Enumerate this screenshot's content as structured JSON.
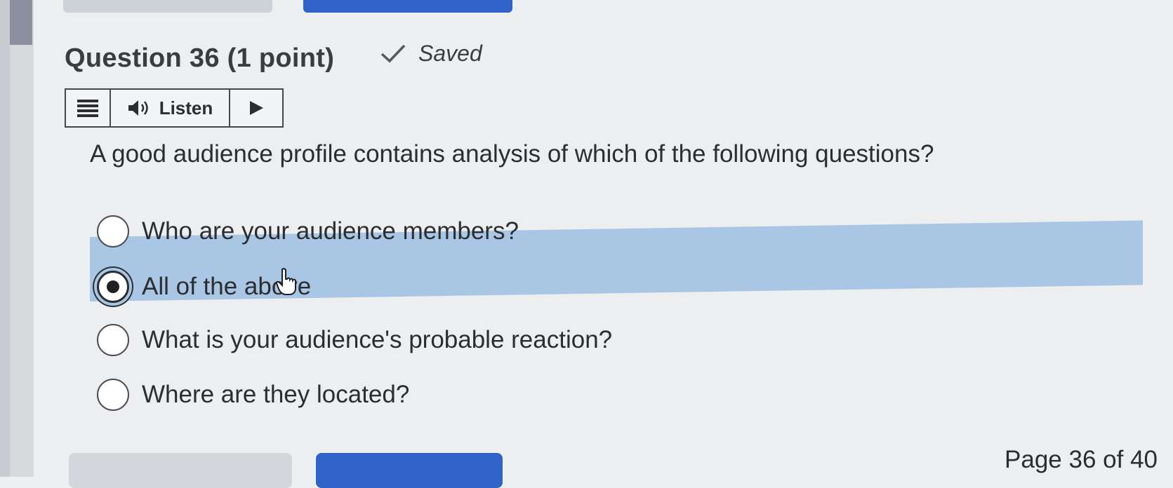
{
  "question": {
    "title": "Question 36 (1 point)",
    "status": "Saved",
    "text": "A good audience profile contains analysis of which of the following questions?"
  },
  "listen_toolbar": {
    "label": "Listen",
    "icons": [
      "menu-icon",
      "speaker-icon",
      "play-icon"
    ]
  },
  "options": [
    {
      "label": "Who are your audience members?",
      "selected": false
    },
    {
      "label": "All of the above",
      "selected": true
    },
    {
      "label": "What is your audience's probable reaction?",
      "selected": false
    },
    {
      "label": "Where are they located?",
      "selected": false
    }
  ],
  "pagination": {
    "text": "Page 36 of 40"
  },
  "colors": {
    "selected_highlight": "#a9c7e4",
    "primary_button": "#2f63c7",
    "secondary_button": "#d3d6db"
  }
}
